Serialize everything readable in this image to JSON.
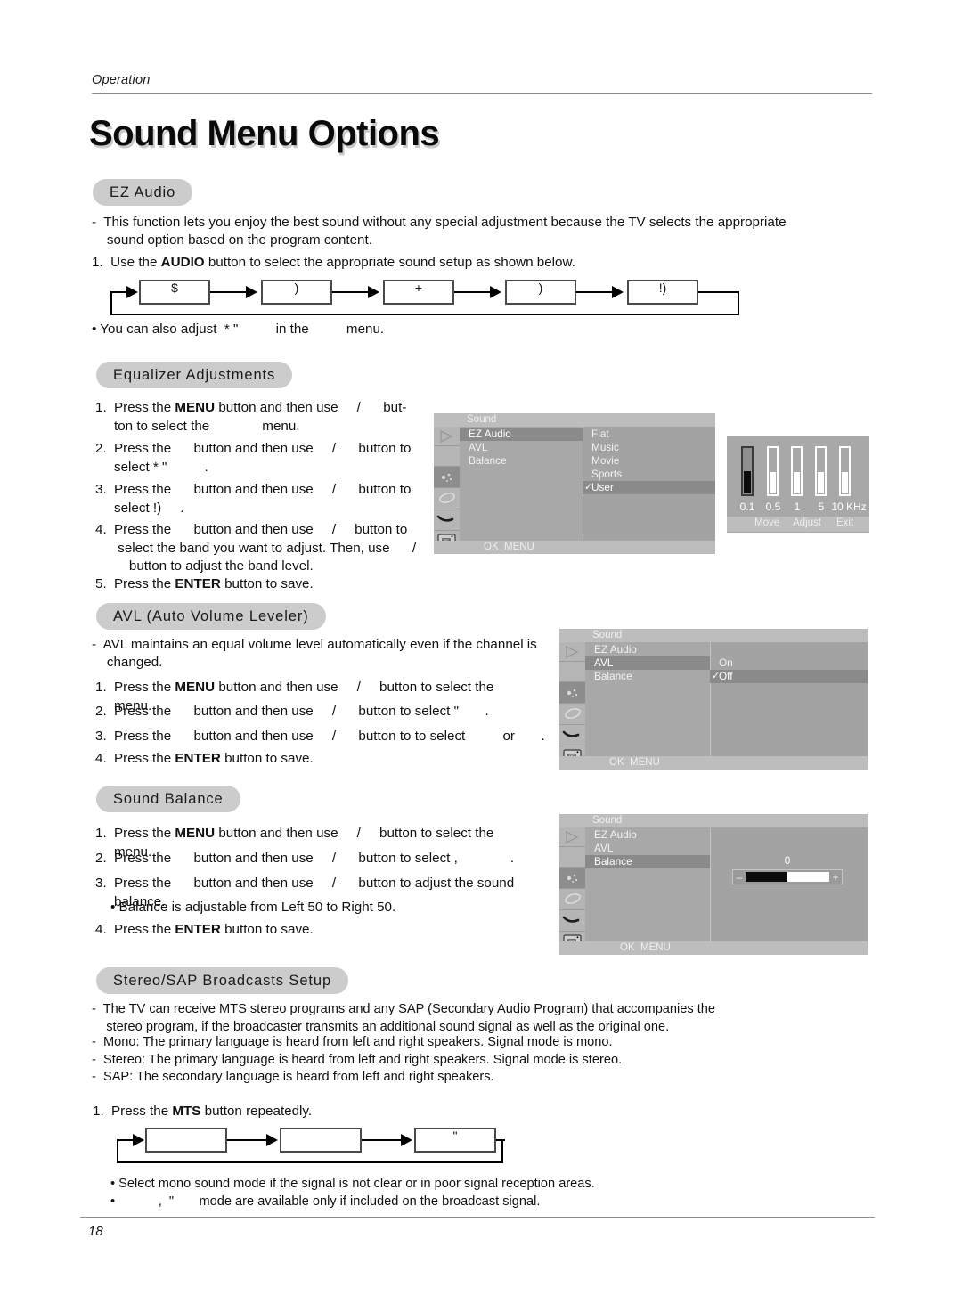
{
  "page": {
    "header_label": "Operation",
    "title": "Sound Menu Options",
    "number": "18"
  },
  "sections": {
    "ez_audio": {
      "pill": "EZ Audio",
      "bullet": "-  This function lets you enjoy the best sound without any special adjustment because the TV selects the appropriate\n    sound option based on the program content.",
      "step1_pre": "1.  Use the ",
      "step1_bold": "AUDIO",
      "step1_post": " button to select the appropriate sound setup as shown below.",
      "flow_boxes": [
        "$",
        ")",
        "+",
        ")",
        "!)"
      ],
      "note": "• You can also adjust  * \"          in the          menu."
    },
    "equalizer": {
      "pill": "Equalizer Adjustments",
      "steps": [
        {
          "num": "1.",
          "pre": "Press the ",
          "bold": "MENU",
          "post": " button and then use     /      but-\nton to select the              menu."
        },
        {
          "num": "2.",
          "pre": "Press the      button and then use     /      button to\nselect * \"          .",
          "bold": "",
          "post": ""
        },
        {
          "num": "3.",
          "pre": "Press the      button and then use     /      button to\nselect !)     .",
          "bold": "",
          "post": ""
        },
        {
          "num": "4.",
          "pre": "Press the      button and then use     /     button to\n select the band you want to adjust. Then, use      /\n    button to adjust the band level.",
          "bold": "",
          "post": ""
        },
        {
          "num": "5.",
          "pre": "Press the ",
          "bold": "ENTER",
          "post": " button to save."
        }
      ],
      "osd": {
        "title": "Sound",
        "menu_items": [
          "EZ Audio",
          "AVL",
          "Balance"
        ],
        "highlighted_menu": "EZ Audio",
        "options": [
          "Flat",
          "Music",
          "Movie",
          "Sports",
          "User"
        ],
        "selected_option": "User",
        "check_mark": "✓",
        "footer": [
          "OK",
          "MENU"
        ]
      },
      "eq_panel": {
        "bands": [
          "0.1",
          "0.5",
          "1",
          "5",
          "10 KHz"
        ],
        "levels": [
          48,
          46,
          46,
          46,
          46
        ],
        "selected_band_index": 0,
        "footer": [
          "Move",
          "Adjust",
          "Exit"
        ]
      }
    },
    "avl": {
      "pill": "AVL (Auto Volume Leveler)",
      "bullet": "-  AVL maintains an equal volume level automatically even if the channel is\n    changed.",
      "steps": [
        {
          "num": "1.",
          "pre": "Press the ",
          "bold": "MENU",
          "post": " button and then use     /     button to select the              menu."
        },
        {
          "num": "2.",
          "pre": "Press the      button and then use     /      button to select \"       .",
          "bold": "",
          "post": ""
        },
        {
          "num": "3.",
          "pre": "Press the      button and then use     /      button to to select          or       .",
          "bold": "",
          "post": ""
        },
        {
          "num": "4.",
          "pre": "Press the ",
          "bold": "ENTER",
          "post": " button to save."
        }
      ],
      "osd": {
        "title": "Sound",
        "menu_items": [
          "EZ Audio",
          "AVL",
          "Balance"
        ],
        "highlighted_menu": "AVL",
        "options": [
          "On",
          "Off"
        ],
        "selected_option": "Off",
        "check_mark": "✓",
        "footer": [
          "OK",
          "MENU"
        ]
      }
    },
    "balance": {
      "pill": "Sound Balance",
      "steps": [
        {
          "num": "1.",
          "pre": "Press the ",
          "bold": "MENU",
          "post": " button and then use     /     button to select the              menu."
        },
        {
          "num": "2.",
          "pre": "Press the      button and then use     /      button to select ,              .",
          "bold": "",
          "post": ""
        },
        {
          "num": "3.",
          "pre": "Press the      button and then use     /      button to adjust the sound balance.",
          "bold": "",
          "post": ""
        }
      ],
      "note": "• Balance is adjustable from Left 50 to Right 50.",
      "step4_num": "4.",
      "step4_pre": "Press the ",
      "step4_bold": "ENTER",
      "step4_post": " button to save.",
      "osd": {
        "title": "Sound",
        "menu_items": [
          "EZ Audio",
          "AVL",
          "Balance"
        ],
        "highlighted_menu": "Balance",
        "value": "0",
        "minus": "–",
        "plus": "+",
        "footer": [
          "OK",
          "MENU"
        ]
      }
    },
    "stereo_sap": {
      "pill": "Stereo/SAP Broadcasts Setup",
      "bullets": [
        "-  The TV can receive MTS stereo programs and any SAP (Secondary Audio Program) that accompanies the\n    stereo program, if the broadcaster transmits an additional sound signal as well as the original one.",
        "-  Mono: The primary language is heard from left and right speakers. Signal mode is mono.",
        "-  Stereo: The primary language is heard from left and right speakers. Signal mode is stereo.",
        "-  SAP: The secondary language is heard from left and right speakers."
      ],
      "step1_num": "1.",
      "step1_pre": "Press the ",
      "step1_bold": "MTS",
      "step1_post": " button repeatedly.",
      "flow_boxes": [
        "",
        "",
        "\""
      ],
      "notes": [
        "• Select mono sound mode if the signal is not clear or in poor signal reception areas.",
        "•            ,  \"       mode are available only if included on the broadcast signal."
      ]
    }
  },
  "colors": {
    "pill_bg": "#cccccc",
    "osd_bg": "#a8a8a8",
    "osd_highlight": "#8a8a8a",
    "osd_title_bg": "#bdbdbd",
    "rule": "#8d8d8d"
  }
}
